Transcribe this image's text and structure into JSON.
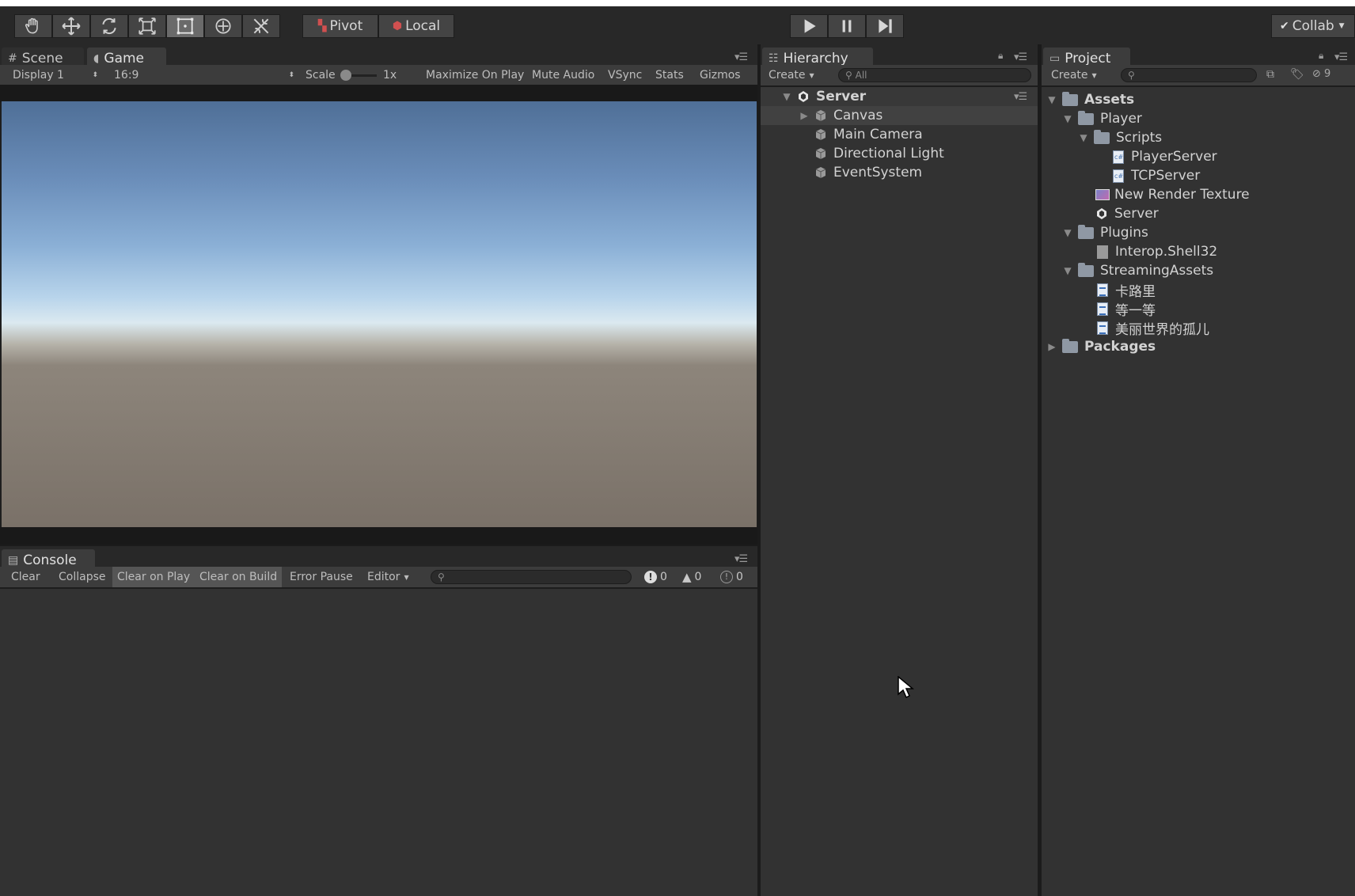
{
  "toolbar": {
    "tools": [
      "hand-tool",
      "move-tool",
      "rotate-tool",
      "scale-tool",
      "rect-tool",
      "transform-tool",
      "custom-tool"
    ],
    "active_tool_index": 4,
    "pivot_label": "Pivot",
    "local_label": "Local",
    "collab_label": "Collab"
  },
  "game_panel": {
    "tabs": [
      {
        "label": "Scene",
        "icon": "grid-icon"
      },
      {
        "label": "Game",
        "icon": "pacman-icon"
      }
    ],
    "selected_tab": "Game",
    "display": "Display 1",
    "aspect": "16:9",
    "scale_label": "Scale",
    "scale_value": "1x",
    "options": [
      "Maximize On Play",
      "Mute Audio",
      "VSync",
      "Stats",
      "Gizmos"
    ]
  },
  "console_panel": {
    "tab_label": "Console",
    "buttons": [
      "Clear",
      "Collapse",
      "Clear on Play",
      "Clear on Build",
      "Error Pause",
      "Editor"
    ],
    "pressed_buttons": [
      "Clear on Play",
      "Clear on Build"
    ],
    "log_count": "0",
    "warning_count": "0",
    "error_count": "0"
  },
  "hierarchy_panel": {
    "tab_label": "Hierarchy",
    "create_label": "Create",
    "search_placeholder": "All",
    "scene_name": "Server",
    "items": [
      {
        "label": "Canvas",
        "expandable": true,
        "selected": true
      },
      {
        "label": "Main Camera",
        "expandable": false,
        "selected": false
      },
      {
        "label": "Directional Light",
        "expandable": false,
        "selected": false
      },
      {
        "label": "EventSystem",
        "expandable": false,
        "selected": false
      }
    ]
  },
  "project_panel": {
    "tab_label": "Project",
    "create_label": "Create",
    "hidden_count": "9",
    "tree": [
      {
        "label": "Assets",
        "type": "folder",
        "bold": true
      },
      {
        "label": "Player",
        "type": "folder"
      },
      {
        "label": "Scripts",
        "type": "folder"
      },
      {
        "label": "PlayerServer",
        "type": "script"
      },
      {
        "label": "TCPServer",
        "type": "script"
      },
      {
        "label": "New Render Texture",
        "type": "render-texture"
      },
      {
        "label": "Server",
        "type": "scene"
      },
      {
        "label": "Plugins",
        "type": "folder"
      },
      {
        "label": "Interop.Shell32",
        "type": "dll"
      },
      {
        "label": "StreamingAssets",
        "type": "folder"
      },
      {
        "label": "卡路里",
        "type": "text"
      },
      {
        "label": "等一等",
        "type": "text"
      },
      {
        "label": "美丽世界的孤儿",
        "type": "text"
      },
      {
        "label": "Packages",
        "type": "folder",
        "bold": true
      }
    ]
  }
}
